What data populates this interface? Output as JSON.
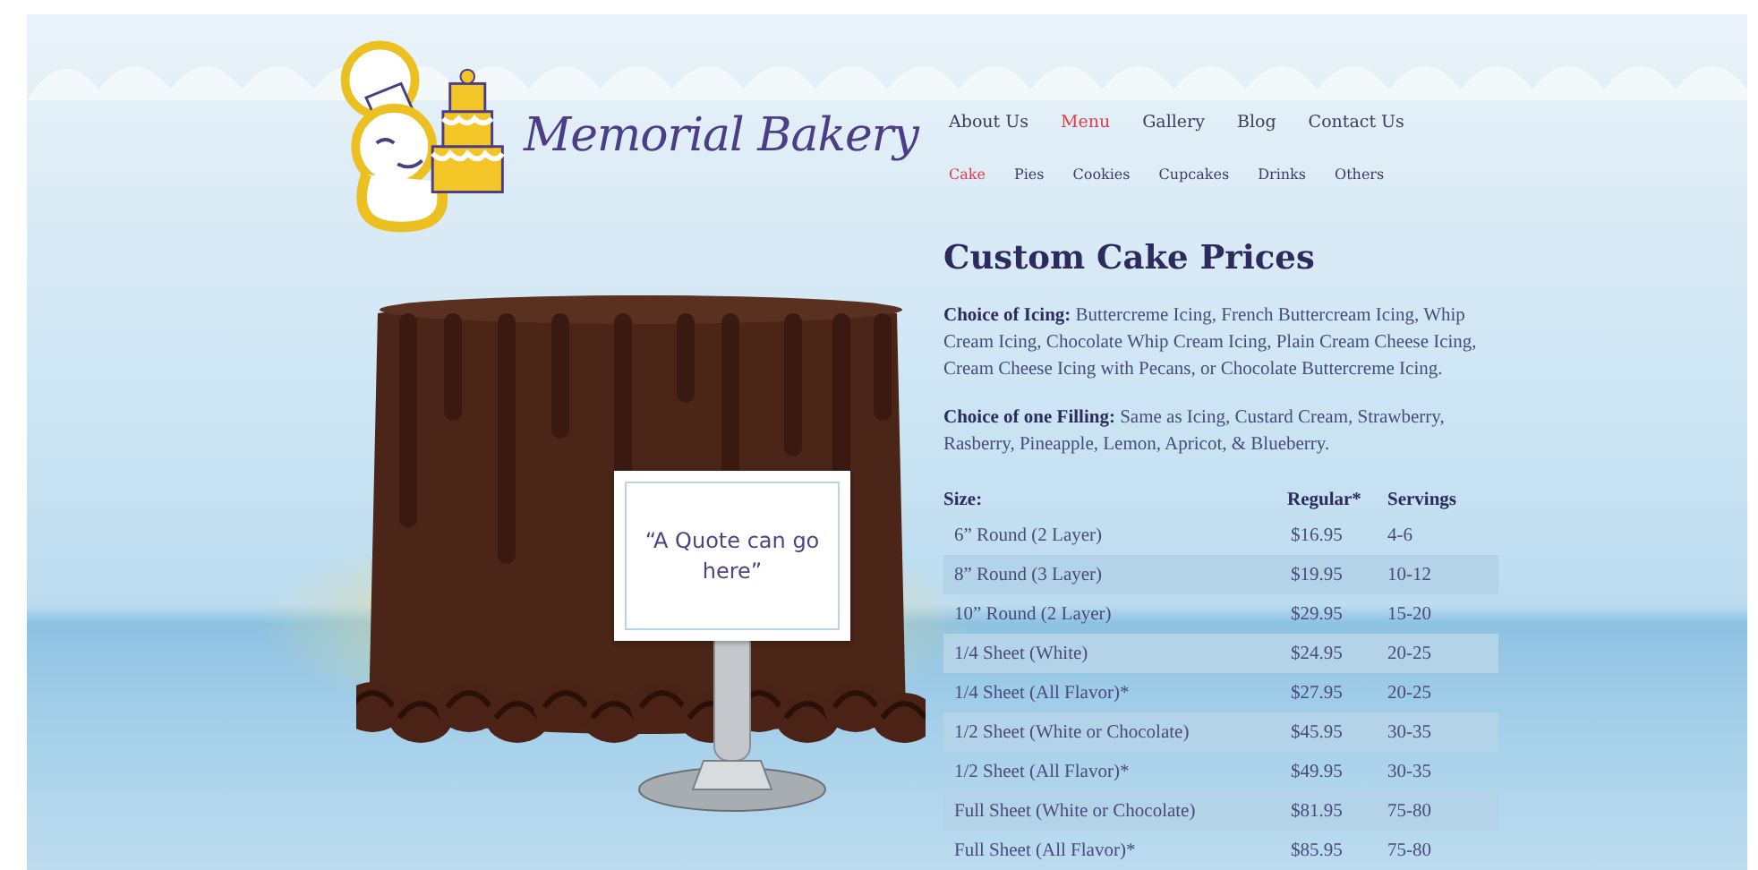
{
  "logo": {
    "name": "Memorial Bakery"
  },
  "main_nav": [
    {
      "label": "About Us",
      "selected": false
    },
    {
      "label": "Menu",
      "selected": true
    },
    {
      "label": "Gallery",
      "selected": false
    },
    {
      "label": "Blog",
      "selected": false
    },
    {
      "label": "Contact Us",
      "selected": false
    }
  ],
  "sub_nav": [
    {
      "label": "Cake",
      "selected": true
    },
    {
      "label": "Pies",
      "selected": false
    },
    {
      "label": "Cookies",
      "selected": false
    },
    {
      "label": "Cupcakes",
      "selected": false
    },
    {
      "label": "Drinks",
      "selected": false
    },
    {
      "label": "Others",
      "selected": false
    }
  ],
  "quote_card": {
    "text": "“A Quote can go here”"
  },
  "heading": "Custom Cake Prices",
  "paragraphs": [
    "**Choice of Icing:** Buttercreme Icing, French Buttercream Icing, Whip Cream Icing, Chocolate Whip Cream Icing, Plain Cream Cheese Icing, Cream Cheese Icing with Pecans, or Chocolate Buttercreme Icing.",
    "**Choice of one Filling:** Same as Icing, Custard Cream, Strawberry, Rasberry, Pineapple, Lemon, Apricot, & Blueberry."
  ],
  "table": {
    "columns": [
      "Size:",
      "Regular*",
      "Servings"
    ],
    "rows": [
      [
        "6” Round (2 Layer)",
        "$16.95",
        "4-6"
      ],
      [
        "8” Round (3 Layer)",
        "$19.95",
        "10-12"
      ],
      [
        "10” Round (2 Layer)",
        "$29.95",
        "15-20"
      ],
      [
        "1/4 Sheet (White)",
        "$24.95",
        "20-25"
      ],
      [
        "1/4 Sheet (All Flavor)*",
        "$27.95",
        "20-25"
      ],
      [
        "1/2 Sheet (White or Chocolate)",
        "$45.95",
        "30-35"
      ],
      [
        "1/2 Sheet (All Flavor)*",
        "$49.95",
        "30-35"
      ],
      [
        "Full Sheet (White or Chocolate)",
        "$81.95",
        "75-80"
      ],
      [
        "Full Sheet (All Flavor)*",
        "$85.95",
        "75-80"
      ]
    ]
  }
}
